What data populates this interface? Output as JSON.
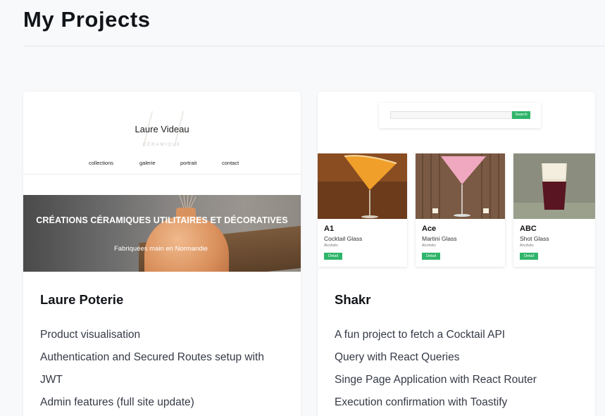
{
  "page": {
    "title": "My Projects"
  },
  "projects": [
    {
      "title": "Laure Poterie",
      "preview": {
        "brand": "Laure Videau",
        "brand_sub": "CÉRAMIQUE",
        "nav": [
          "collections",
          "galerie",
          "portrait",
          "contact"
        ],
        "banner_title": "CRÉATIONS CÉRAMIQUES UTILITAIRES ET DÉCORATIVES",
        "banner_subtitle": "Fabriquées main en Normandie"
      },
      "features": [
        "Product visualisation",
        "Authentication and Secured Routes setup with",
        "JWT",
        "Admin features (full site update)"
      ]
    },
    {
      "title": "Shakr",
      "preview": {
        "search_button": "Search",
        "cocktails": [
          {
            "name": "A1",
            "glass": "Cocktail Glass",
            "type": "Alcoholic",
            "button": "Detail"
          },
          {
            "name": "Ace",
            "glass": "Martini Glass",
            "type": "Alcoholic",
            "button": "Detail"
          },
          {
            "name": "ABC",
            "glass": "Shot Glass",
            "type": "Alcoholic",
            "button": "Detail"
          }
        ]
      },
      "features": [
        "A fun project to fetch a Cocktail API",
        "Query with React Queries",
        "Singe Page Application with React Router",
        "Execution confirmation with Toastify"
      ]
    }
  ]
}
